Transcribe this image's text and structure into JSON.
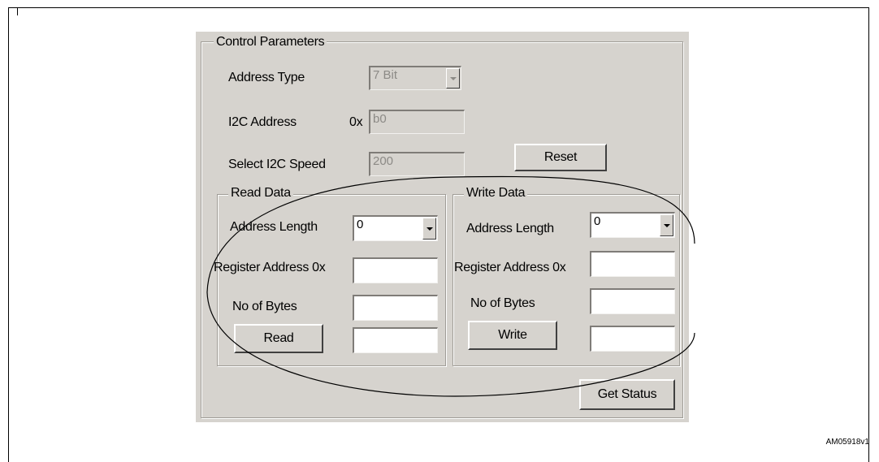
{
  "control_parameters": {
    "legend": "Control Parameters",
    "address_type_label": "Address Type",
    "address_type_value": "7 Bit",
    "i2c_address_label": "I2C Address",
    "i2c_address_prefix": "0x",
    "i2c_address_value": "b0",
    "i2c_speed_label": "Select I2C Speed",
    "i2c_speed_value": "200",
    "reset_label": "Reset"
  },
  "read_data": {
    "legend": "Read Data",
    "address_length_label": "Address Length",
    "address_length_value": "0",
    "register_address_label": "Register Address 0x",
    "register_address_value": "",
    "bytes_label": "No of Bytes",
    "bytes_value": "",
    "read_label": "Read",
    "result_value": ""
  },
  "write_data": {
    "legend": "Write Data",
    "address_length_label": "Address Length",
    "address_length_value": "0",
    "register_address_label": "Register Address 0x",
    "register_address_value": "",
    "bytes_label": "No of Bytes",
    "bytes_value": "",
    "write_label": "Write",
    "data_value": ""
  },
  "get_status_label": "Get Status",
  "figure_code": "AM05918v1",
  "colors": {
    "panel": "#d6d3ce",
    "field": "#ffffff",
    "disabled_text": "#8c8a86"
  },
  "icons": {
    "dropdown": "chevron-down-icon",
    "highlight": "ellipse-annotation"
  }
}
